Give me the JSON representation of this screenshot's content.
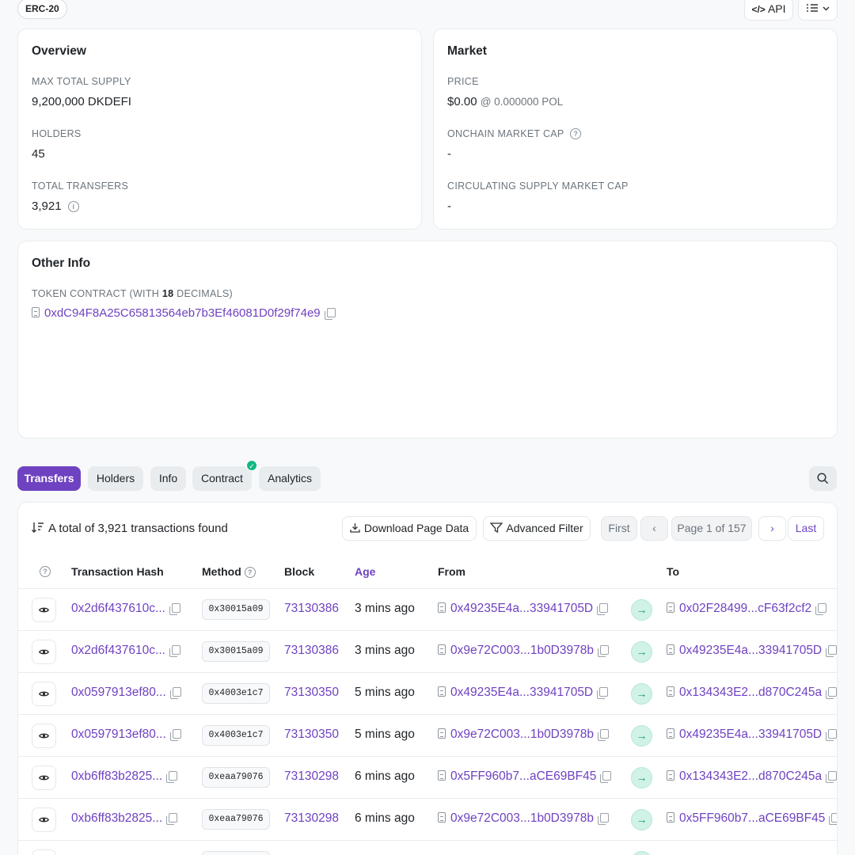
{
  "header": {
    "token_standard": "ERC-20",
    "api_label": "API",
    "menu_label": "☰"
  },
  "overview": {
    "title": "Overview",
    "max_supply_label": "MAX TOTAL SUPPLY",
    "max_supply_value": "9,200,000 DKDEFI",
    "holders_label": "HOLDERS",
    "holders_value": "45",
    "transfers_label": "TOTAL TRANSFERS",
    "transfers_value": "3,921"
  },
  "market": {
    "title": "Market",
    "price_label": "PRICE",
    "price_value": "$0.00",
    "price_native": "@ 0.000000 POL",
    "onchain_cap_label": "ONCHAIN MARKET CAP",
    "onchain_cap_value": "-",
    "circ_cap_label": "CIRCULATING SUPPLY MARKET CAP",
    "circ_cap_value": "-"
  },
  "other_info": {
    "title": "Other Info",
    "contract_label_prefix": "TOKEN CONTRACT (WITH",
    "decimals": "18",
    "contract_label_suffix": "DECIMALS)",
    "contract_address": "0xdC94F8A25C65813564eb7b3Ef46081D0f29f74e9"
  },
  "tabs": [
    "Transfers",
    "Holders",
    "Info",
    "Contract",
    "Analytics"
  ],
  "table": {
    "total_text": "A total of 3,921 transactions found",
    "download_label": "Download Page Data",
    "filter_label": "Advanced Filter",
    "pagination": {
      "first": "First",
      "prev": "‹",
      "page": "Page 1 of 157",
      "next": "›",
      "last": "Last"
    },
    "columns": {
      "hash": "Transaction Hash",
      "method": "Method",
      "block": "Block",
      "age": "Age",
      "from": "From",
      "to": "To"
    },
    "rows": [
      {
        "hash": "0x2d6f437610c...",
        "method": "0x30015a09",
        "block": "73130386",
        "age": "3 mins ago",
        "from": "0x49235E4a...33941705D",
        "to": "0x02F28499...cF63f2cf2"
      },
      {
        "hash": "0x2d6f437610c...",
        "method": "0x30015a09",
        "block": "73130386",
        "age": "3 mins ago",
        "from": "0x9e72C003...1b0D3978b",
        "to": "0x49235E4a...33941705D"
      },
      {
        "hash": "0x0597913ef80...",
        "method": "0x4003e1c7",
        "block": "73130350",
        "age": "5 mins ago",
        "from": "0x49235E4a...33941705D",
        "to": "0x134343E2...d870C245a"
      },
      {
        "hash": "0x0597913ef80...",
        "method": "0x4003e1c7",
        "block": "73130350",
        "age": "5 mins ago",
        "from": "0x9e72C003...1b0D3978b",
        "to": "0x49235E4a...33941705D"
      },
      {
        "hash": "0xb6ff83b2825...",
        "method": "0xeaa79076",
        "block": "73130298",
        "age": "6 mins ago",
        "from": "0x5FF960b7...aCE69BF45",
        "to": "0x134343E2...d870C245a"
      },
      {
        "hash": "0xb6ff83b2825...",
        "method": "0xeaa79076",
        "block": "73130298",
        "age": "6 mins ago",
        "from": "0x9e72C003...1b0D3978b",
        "to": "0x5FF960b7...aCE69BF45"
      }
    ]
  },
  "colors": {
    "accent": "#6f42c1",
    "verified": "#10b981",
    "arrow_bg": "#d1f2e6"
  }
}
